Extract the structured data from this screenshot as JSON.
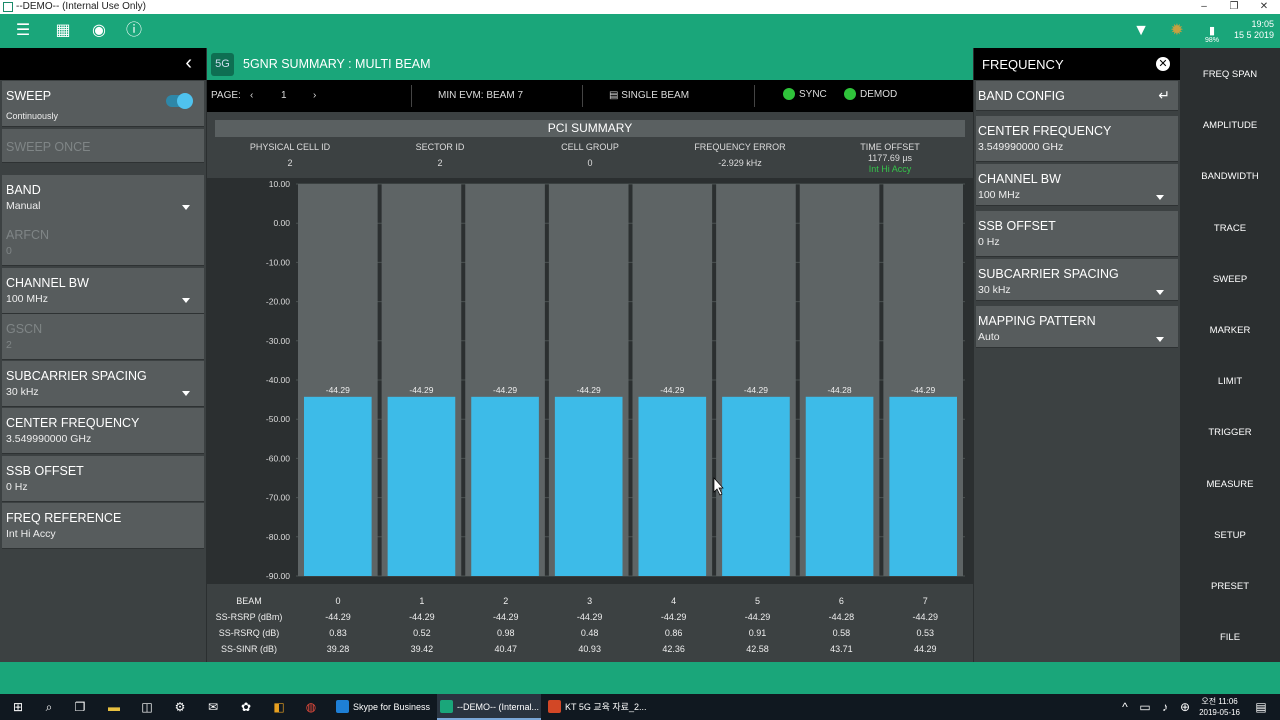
{
  "window": {
    "title": "--DEMO-- (Internal Use Only)"
  },
  "toolbar": {
    "time": "19:05",
    "date": "15 5 2019",
    "battery": "98%"
  },
  "left_panel": {
    "items": [
      {
        "label": "SWEEP",
        "value": "Continuously",
        "type": "toggle",
        "disabled": false
      },
      {
        "label": "SWEEP ONCE",
        "value": "",
        "type": "button",
        "disabled": true
      },
      {
        "label": "BAND",
        "value": "Manual",
        "type": "dropdown",
        "disabled": false
      },
      {
        "label": "ARFCN",
        "value": "0",
        "type": "field",
        "disabled": true
      },
      {
        "label": "CHANNEL BW",
        "value": "100 MHz",
        "type": "dropdown",
        "disabled": false
      },
      {
        "label": "GSCN",
        "value": "2",
        "type": "field",
        "disabled": true
      },
      {
        "label": "SUBCARRIER SPACING",
        "value": "30 kHz",
        "type": "dropdown",
        "disabled": false
      },
      {
        "label": "CENTER FREQUENCY",
        "value": "3.549990000 GHz",
        "type": "field",
        "disabled": false
      },
      {
        "label": "SSB OFFSET",
        "value": "0 Hz",
        "type": "field",
        "disabled": false
      },
      {
        "label": "FREQ REFERENCE",
        "value": "Int Hi Accy",
        "type": "field",
        "disabled": false
      }
    ]
  },
  "center": {
    "title": "5GNR SUMMARY : MULTI BEAM",
    "page_label": "PAGE:",
    "page_number": "1",
    "min_evm": "MIN EVM: BEAM 7",
    "single_beam": "SINGLE BEAM",
    "sync": "SYNC",
    "demod": "DEMOD",
    "pci": {
      "title": "PCI SUMMARY",
      "columns": [
        {
          "label": "PHYSICAL CELL ID",
          "value": "2"
        },
        {
          "label": "SECTOR ID",
          "value": "2"
        },
        {
          "label": "CELL GROUP",
          "value": "0"
        },
        {
          "label": "FREQUENCY ERROR",
          "value": "-2.929 kHz"
        },
        {
          "label": "TIME OFFSET",
          "value": "1177.69 µs",
          "extra": "Int Hi Accy"
        }
      ]
    },
    "table": {
      "row_labels": [
        "BEAM",
        "SS-RSRP (dBm)",
        "SS-RSRQ (dB)",
        "SS-SINR (dB)"
      ],
      "beams": [
        "0",
        "1",
        "2",
        "3",
        "4",
        "5",
        "6",
        "7"
      ],
      "rsrp": [
        "-44.29",
        "-44.29",
        "-44.29",
        "-44.29",
        "-44.29",
        "-44.29",
        "-44.28",
        "-44.29"
      ],
      "rsrq": [
        "0.83",
        "0.52",
        "0.98",
        "0.48",
        "0.86",
        "0.91",
        "0.58",
        "0.53"
      ],
      "sinr": [
        "39.28",
        "39.42",
        "40.47",
        "40.93",
        "42.36",
        "42.58",
        "43.71",
        "44.29"
      ]
    }
  },
  "chart_data": {
    "type": "bar",
    "categories": [
      "0",
      "1",
      "2",
      "3",
      "4",
      "5",
      "6",
      "7"
    ],
    "values": [
      -44.29,
      -44.29,
      -44.29,
      -44.29,
      -44.29,
      -44.29,
      -44.28,
      -44.29
    ],
    "data_labels": [
      "-44.29",
      "-44.29",
      "-44.29",
      "-44.29",
      "-44.29",
      "-44.29",
      "-44.28",
      "-44.29"
    ],
    "ylim": [
      -90,
      10
    ],
    "yticks": [
      "10.00",
      "0.00",
      "-10.00",
      "-20.00",
      "-30.00",
      "-40.00",
      "-50.00",
      "-60.00",
      "-70.00",
      "-80.00",
      "-90.00"
    ],
    "bar_color": "#3dbbe8",
    "background_bar_color": "#5e6465",
    "grid": true
  },
  "freq_panel": {
    "title": "FREQUENCY",
    "items": [
      {
        "label": "BAND CONFIG",
        "value": "",
        "type": "enter"
      },
      {
        "label": "CENTER FREQUENCY",
        "value": "3.549990000 GHz",
        "type": "field"
      },
      {
        "label": "CHANNEL BW",
        "value": "100 MHz",
        "type": "dropdown"
      },
      {
        "label": "SSB OFFSET",
        "value": "0 Hz",
        "type": "field"
      },
      {
        "label": "SUBCARRIER SPACING",
        "value": "30 kHz",
        "type": "dropdown"
      },
      {
        "label": "MAPPING PATTERN",
        "value": "Auto",
        "type": "dropdown"
      }
    ]
  },
  "right_menu": {
    "items": [
      "FREQ SPAN",
      "AMPLITUDE",
      "BANDWIDTH",
      "TRACE",
      "SWEEP",
      "MARKER",
      "LIMIT",
      "TRIGGER",
      "MEASURE",
      "SETUP",
      "PRESET",
      "FILE"
    ]
  },
  "taskbar": {
    "apps": [
      {
        "label": "Skype for Business",
        "color": "#1e7fd6"
      },
      {
        "label": "--DEMO-- (Internal...",
        "color": "#1aa67a"
      },
      {
        "label": "KT 5G 교육 자료_2...",
        "color": "#d24726"
      }
    ],
    "time": "오전 11:06",
    "date": "2019-05-16"
  },
  "colors": {
    "accent_green": "#1aa67a",
    "bar_blue": "#3dbbe8",
    "led_green": "#2fc33a"
  }
}
